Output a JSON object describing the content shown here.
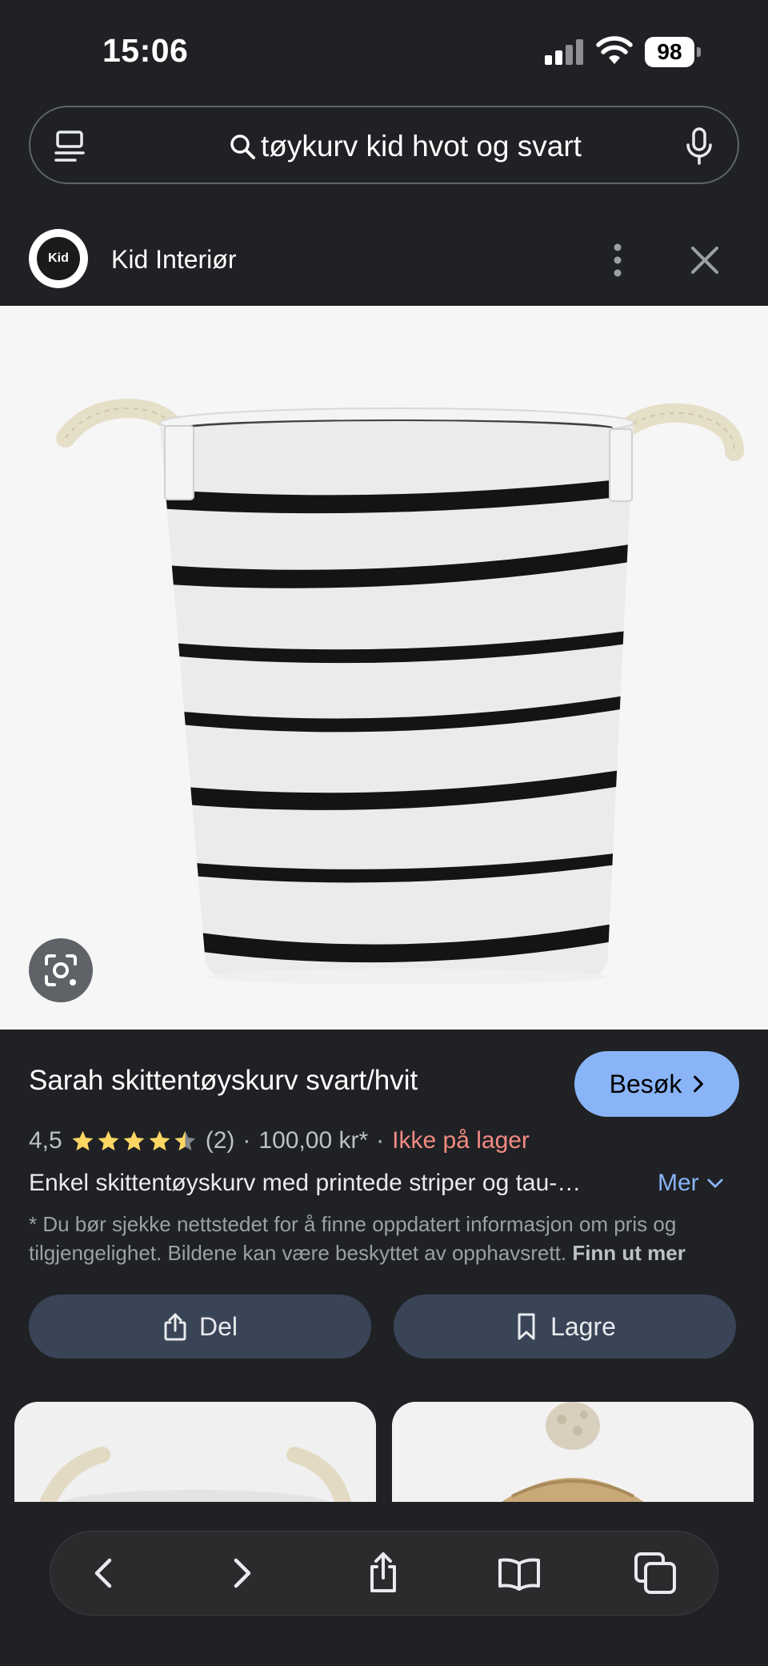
{
  "status_bar": {
    "time": "15:06",
    "battery": "98"
  },
  "search": {
    "query": "tøykurv kid hvot og svart"
  },
  "source": {
    "logo_text": "Kid",
    "name": "Kid Interiør"
  },
  "product": {
    "title": "Sarah skittentøyskurv svart/hvit",
    "visit_label": "Besøk",
    "rating": "4,5",
    "rating_stars": 4.5,
    "review_count": "(2)",
    "separator": "·",
    "price": "100,00 kr*",
    "stock_status": "Ikke på lager",
    "description": "Enkel skittentøyskurv med printede striper og tau-…",
    "more_label": "Mer",
    "disclaimer": "* Du bør sjekke nettstedet for å finne oppdatert informasjon om pris og tilgjengelighet. Bildene kan være beskyttet av opphavsrett.",
    "learn_more": "Finn ut mer"
  },
  "actions": {
    "share_label": "Del",
    "save_label": "Lagre"
  },
  "icons": {
    "tabs": "tabs-icon",
    "search": "search-icon",
    "mic": "mic-icon",
    "more": "more-vert-icon",
    "close": "close-icon",
    "lens": "lens-icon",
    "back": "back-icon",
    "forward": "forward-icon",
    "share": "share-icon",
    "bookmarks": "bookmarks-icon",
    "tabs_overview": "tabs-overview-icon"
  },
  "colors": {
    "accent": "#8ab4f8",
    "stock_red": "#f28b82",
    "star": "#fdd663",
    "button_bg": "#394457",
    "background": "#202124"
  }
}
